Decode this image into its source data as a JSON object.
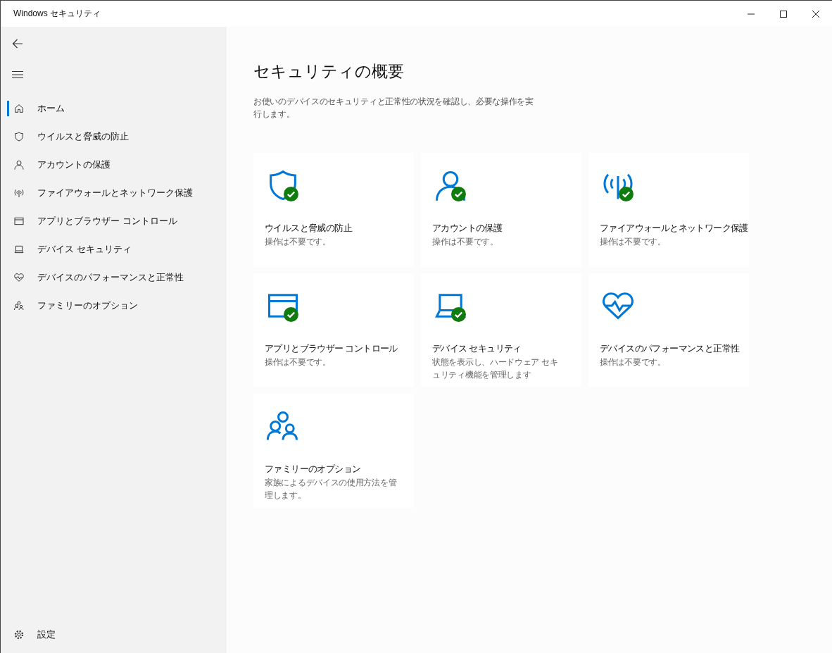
{
  "window": {
    "title": "Windows セキュリティ"
  },
  "sidebar": {
    "items": [
      {
        "label": "ホーム",
        "kind": "home",
        "selected": true
      },
      {
        "label": "ウイルスと脅威の防止",
        "kind": "shield",
        "selected": false
      },
      {
        "label": "アカウントの保護",
        "kind": "person",
        "selected": false
      },
      {
        "label": "ファイアウォールとネットワーク保護",
        "kind": "antenna",
        "selected": false
      },
      {
        "label": "アプリとブラウザー コントロール",
        "kind": "browser",
        "selected": false
      },
      {
        "label": "デバイス セキュリティ",
        "kind": "laptop",
        "selected": false
      },
      {
        "label": "デバイスのパフォーマンスと正常性",
        "kind": "heart",
        "selected": false
      },
      {
        "label": "ファミリーのオプション",
        "kind": "family",
        "selected": false
      }
    ],
    "settings": {
      "label": "設定"
    }
  },
  "page": {
    "title": "セキュリティの概要",
    "description": "お使いのデバイスのセキュリティと正常性の状況を確認し、必要な操作を実行します。"
  },
  "tiles": [
    {
      "kind": "shield",
      "title": "ウイルスと脅威の防止",
      "status": "操作は不要です。",
      "ok": true
    },
    {
      "kind": "person",
      "title": "アカウントの保護",
      "status": "操作は不要です。",
      "ok": true
    },
    {
      "kind": "antenna",
      "title": "ファイアウォールとネットワーク保護",
      "status": "操作は不要です。",
      "ok": true
    },
    {
      "kind": "browser",
      "title": "アプリとブラウザー コントロール",
      "status": "操作は不要です。",
      "ok": true
    },
    {
      "kind": "laptop",
      "title": "デバイス セキュリティ",
      "status": "状態を表示し、ハードウェア セキュリティ機能を管理します",
      "ok": true
    },
    {
      "kind": "heart",
      "title": "デバイスのパフォーマンスと正常性",
      "status": "操作は不要です。",
      "ok": false
    },
    {
      "kind": "family",
      "title": "ファミリーのオプション",
      "status": "家族によるデバイスの使用方法を管理します。",
      "ok": false
    }
  ]
}
